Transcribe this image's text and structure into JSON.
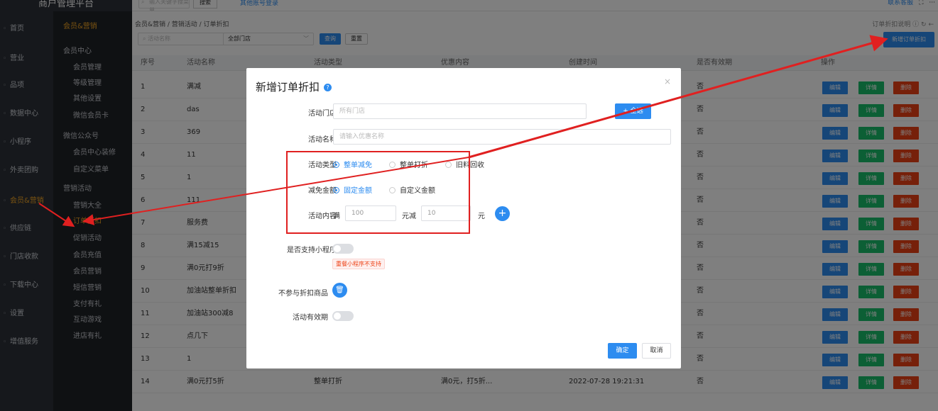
{
  "top": {
    "brand": "商户管理平台",
    "search_placeholder": "输入关键字搜菜单",
    "search_button": "搜索",
    "other_login": "其他账号登录",
    "service_label": "联系客服",
    "fullscreen_icon": "fullscreen-icon",
    "more_icon": "more-icon"
  },
  "sidebar": [
    {
      "label": "首页",
      "icon": "home-icon"
    },
    {
      "label": "营业",
      "icon": "business-icon"
    },
    {
      "label": "品项",
      "icon": "item-icon"
    },
    {
      "label": "数据中心",
      "icon": "data-icon"
    },
    {
      "label": "小程序",
      "icon": "miniapp-icon"
    },
    {
      "label": "外卖团购",
      "icon": "takeout-icon"
    },
    {
      "label": "会员&营销",
      "icon": "member-icon"
    },
    {
      "label": "供应链",
      "icon": "supply-icon"
    },
    {
      "label": "门店收款",
      "icon": "store-icon"
    },
    {
      "label": "下载中心",
      "icon": "download-icon"
    },
    {
      "label": "设置",
      "icon": "settings-icon"
    },
    {
      "label": "增值服务",
      "icon": "value-icon"
    }
  ],
  "submenu": {
    "header": "会员&营销",
    "items": [
      {
        "label": "会员中心",
        "level": 1
      },
      {
        "label": "会员管理",
        "level": 2
      },
      {
        "label": "等级管理",
        "level": 2
      },
      {
        "label": "其他设置",
        "level": 2
      },
      {
        "label": "微信会员卡",
        "level": 2
      },
      {
        "label": "微信公众号",
        "level": 1
      },
      {
        "label": "会员中心装修",
        "level": 2
      },
      {
        "label": "自定义菜单",
        "level": 2
      },
      {
        "label": "营销活动",
        "level": 1
      },
      {
        "label": "营销大全",
        "level": 2
      },
      {
        "label": "订单折扣",
        "level": 2,
        "active": true
      },
      {
        "label": "促销活动",
        "level": 2
      },
      {
        "label": "会员充值",
        "level": 2
      },
      {
        "label": "会员营销",
        "level": 2
      },
      {
        "label": "短信营销",
        "level": 2
      },
      {
        "label": "支付有礼",
        "level": 2
      },
      {
        "label": "互动游戏",
        "level": 2
      },
      {
        "label": "进店有礼",
        "level": 2
      }
    ]
  },
  "main": {
    "breadcrumb": "会员&营销 / 营销活动 / 订单折扣",
    "help_text": "订单折扣说明 ⓘ",
    "filter_placeholder": "活动名称",
    "store_select": "全部门店",
    "query_button": "查询",
    "reset_button": "重置",
    "new_button": "新增订单折扣",
    "columns": [
      "序号",
      "活动名称",
      "活动类型",
      "优惠内容",
      "创建时间",
      "是否有效期",
      "操作"
    ],
    "rows": [
      {
        "no": "1",
        "name": "满减",
        "type": "",
        "content": "",
        "time": "",
        "valid": "否"
      },
      {
        "no": "2",
        "name": "das",
        "type": "",
        "content": "",
        "time": "",
        "valid": "否"
      },
      {
        "no": "3",
        "name": "369",
        "type": "",
        "content": "",
        "time": "",
        "valid": "否"
      },
      {
        "no": "4",
        "name": "11",
        "type": "",
        "content": "",
        "time": "",
        "valid": "否"
      },
      {
        "no": "5",
        "name": "1",
        "type": "",
        "content": "",
        "time": "",
        "valid": "否"
      },
      {
        "no": "6",
        "name": "111",
        "type": "",
        "content": "",
        "time": "",
        "valid": "否"
      },
      {
        "no": "7",
        "name": "服务费",
        "type": "",
        "content": "",
        "time": "",
        "valid": "否"
      },
      {
        "no": "8",
        "name": "满15减15",
        "type": "",
        "content": "",
        "time": "",
        "valid": "否"
      },
      {
        "no": "9",
        "name": "满0元打9折",
        "type": "",
        "content": "",
        "time": "",
        "valid": "否"
      },
      {
        "no": "10",
        "name": "加油站整单折扣",
        "type": "",
        "content": "",
        "time": "",
        "valid": "否"
      },
      {
        "no": "11",
        "name": "加油站300减8",
        "type": "",
        "content": "",
        "time": "",
        "valid": "否"
      },
      {
        "no": "12",
        "name": "点几下",
        "type": "",
        "content": "",
        "time": "",
        "valid": "否"
      },
      {
        "no": "13",
        "name": "1",
        "type": "",
        "content": "",
        "time": "",
        "valid": "否"
      },
      {
        "no": "14",
        "name": "满0元打5折",
        "type": "整单打折",
        "content": "满0元，打5折...",
        "time": "2022-07-28 19:21:31",
        "valid": "否"
      }
    ],
    "actions": {
      "edit": "编辑",
      "detail": "详情",
      "delete": "删除"
    }
  },
  "modal": {
    "title": "新增订单折扣",
    "store_label": "活动门店",
    "store_placeholder": "所有门店",
    "select_all": "+ 全选",
    "name_label": "活动名称",
    "name_placeholder": "请输入优惠名称",
    "type_label": "活动类型",
    "type_options": [
      "整单减免",
      "整单打折",
      "旧料回收"
    ],
    "amount_label": "减免金额",
    "amount_options": [
      "固定金额",
      "自定义金额"
    ],
    "content_label": "活动内容",
    "content_prefix": "满",
    "content_value1": "100",
    "content_mid": "元减",
    "content_value2": "10",
    "content_suffix": "元",
    "miniapp_label": "是否支持小程序",
    "miniapp_warning": "重餐小程序不支持",
    "exclude_label": "不参与折扣商品",
    "validity_label": "活动有效期",
    "ok_button": "确定",
    "cancel_button": "取消"
  },
  "colors": {
    "accent": "#2d8cf0",
    "success": "#19be6b",
    "danger": "#ed4014",
    "annotation": "#e02020",
    "sidebar": "#2d3138"
  }
}
